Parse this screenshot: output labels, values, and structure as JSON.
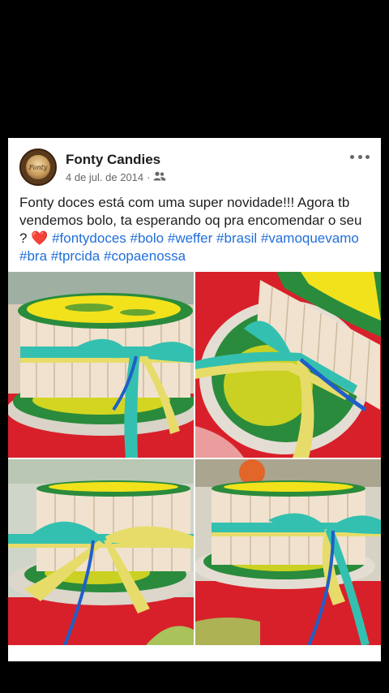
{
  "post": {
    "page_name": "Fonty Candies",
    "date": "4 de jul. de 2014",
    "separator": "·",
    "privacy_icon": "friends-icon",
    "more_icon": "more-horizontal-icon",
    "text_intro": "Fonty doces está com uma super novidade!!! Agora tb vendemos bolo, ta esperando oq pra encomendar o seu ? ",
    "heart_emoji": "❤️",
    "hashtags": [
      "#fontydoces",
      "#bolo",
      "#weffer",
      "#brasil",
      "#vamoquevamo",
      "#bra",
      "#tprcida",
      "#copaenossa"
    ]
  },
  "avatar": {
    "logo_text": "Fonty"
  },
  "colors": {
    "link": "#216fdb",
    "tablecloth": "#d8202a",
    "wafer": "#f0e2cf",
    "candy_yellow": "#f2e21c",
    "candy_green": "#1f8a3a",
    "ribbon_green": "#34c0b0",
    "ribbon_yellow": "#e7dc6a",
    "ribbon_blue": "#1f5fc8"
  },
  "photos": [
    {
      "name": "cake-photo-1",
      "subject": "cake-top-view"
    },
    {
      "name": "cake-photo-2",
      "subject": "cake-angled-view"
    },
    {
      "name": "cake-photo-3",
      "subject": "cake-side-view-left"
    },
    {
      "name": "cake-photo-4",
      "subject": "cake-side-view-right"
    }
  ]
}
